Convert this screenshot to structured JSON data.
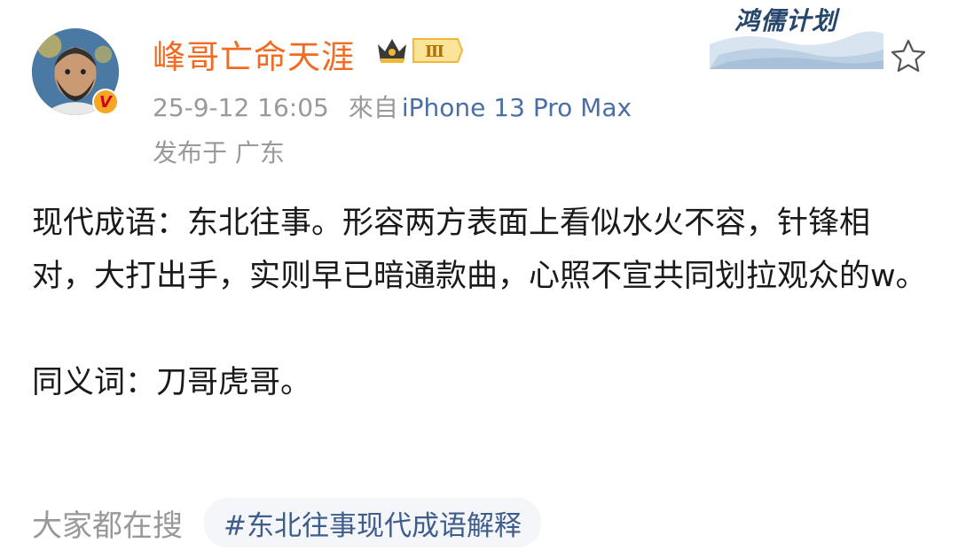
{
  "post": {
    "author": {
      "name": "峰哥亡命天涯",
      "level_badge": "Ⅲ",
      "verified_mark": "V"
    },
    "timestamp": "25-9-12 16:05",
    "source_label": "來自",
    "device": "iPhone 13 Pro Max",
    "location": "发布于 广东",
    "campaign_label": "鸿儒计划",
    "body": {
      "paragraph1": "现代成语：东北往事。形容两方表面上看似水火不容，针锋相对，大打出手，实则早已暗通款曲，心照不宣共同划拉观众的w。",
      "paragraph2": "同义词：刀哥虎哥。"
    },
    "trending": {
      "label": "大家都在搜",
      "tag": "#东北往事现代成语解释"
    }
  },
  "icons": {
    "favorite": "star-icon",
    "avatar": "avatar-portrait",
    "verified": "verified-badge-icon",
    "level": "crown-icon"
  },
  "colors": {
    "username": "#f36b21",
    "device_link": "#4a6fa5",
    "meta_gray": "#999999",
    "tag_text": "#3e5d8a",
    "tag_bg": "#f4f6fa"
  }
}
